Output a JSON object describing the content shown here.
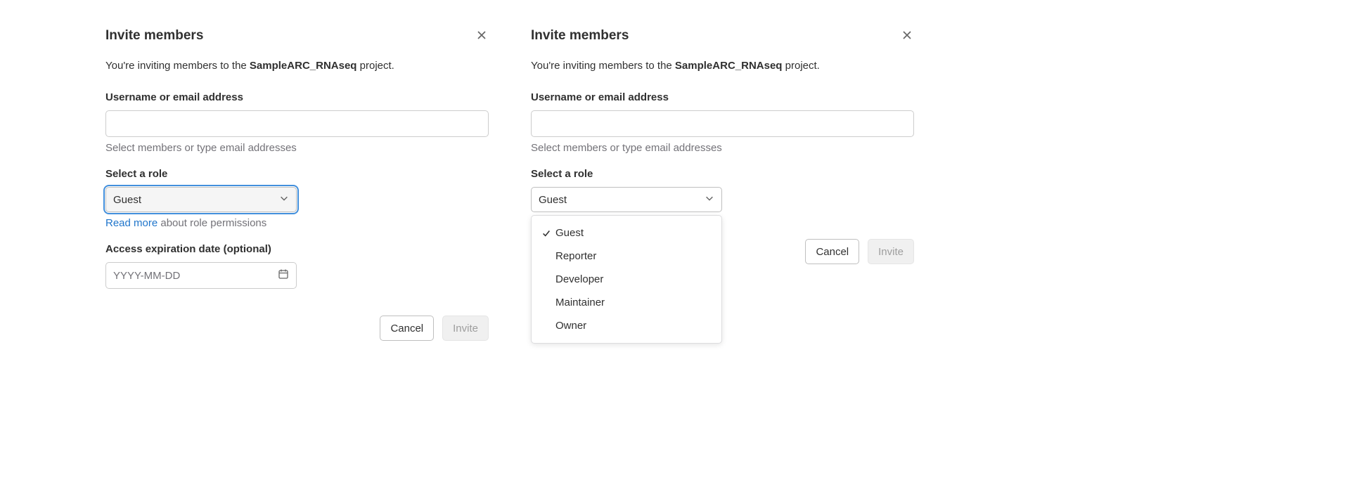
{
  "left": {
    "title": "Invite members",
    "description_prefix": "You're inviting members to the ",
    "project_name": "SampleARC_RNAseq",
    "description_suffix": " project.",
    "username_label": "Username or email address",
    "username_helper": "Select members or type email addresses",
    "role_label": "Select a role",
    "role_value": "Guest",
    "role_readmore": "Read more",
    "role_helper_rest": " about role permissions",
    "expiration_label": "Access expiration date (optional)",
    "expiration_placeholder": "YYYY-MM-DD",
    "cancel": "Cancel",
    "invite": "Invite"
  },
  "right": {
    "title": "Invite members",
    "description_prefix": "You're inviting members to the ",
    "project_name": "SampleARC_RNAseq",
    "description_suffix": " project.",
    "username_label": "Username or email address",
    "username_helper": "Select members or type email addresses",
    "role_label": "Select a role",
    "role_value": "Guest",
    "role_options": [
      {
        "label": "Guest",
        "selected": true
      },
      {
        "label": "Reporter",
        "selected": false
      },
      {
        "label": "Developer",
        "selected": false
      },
      {
        "label": "Maintainer",
        "selected": false
      },
      {
        "label": "Owner",
        "selected": false
      }
    ],
    "cancel": "Cancel",
    "invite": "Invite"
  }
}
